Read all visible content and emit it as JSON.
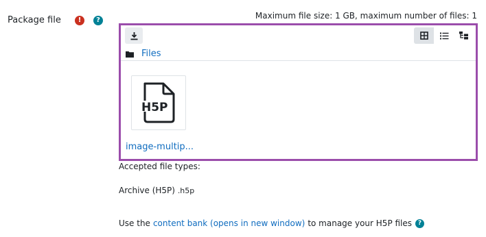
{
  "field": {
    "label": "Package file",
    "required_icon": "exclamation-icon",
    "help_icon": "question-icon",
    "required_glyph": "!",
    "help_glyph": "?"
  },
  "limits": {
    "text": "Maximum file size: 1 GB, maximum number of files: 1"
  },
  "filepicker": {
    "download_icon": "download-icon",
    "views": [
      "icons-view-icon",
      "list-view-icon",
      "tree-view-icon"
    ],
    "active_view": "icons-view-icon",
    "path_icon": "folder-icon",
    "path_label": "Files",
    "file": {
      "name": "image-multip...",
      "type_icon": "h5p-file-icon",
      "icon_text": "H5P"
    }
  },
  "accepted": {
    "label": "Accepted file types:",
    "type_name": "Archive (H5P)",
    "type_ext": ".h5p"
  },
  "footer": {
    "prefix": "Use the",
    "link": "content bank (opens in new window)",
    "suffix": "to manage your H5P files",
    "help_icon": "question-icon",
    "help_glyph": "?"
  },
  "colors": {
    "highlight_border": "#9b4dab",
    "link": "#0f6cbf",
    "required": "#ca3120",
    "help": "#008196"
  }
}
